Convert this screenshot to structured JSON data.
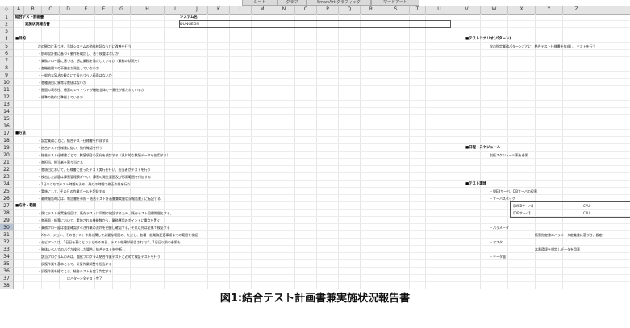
{
  "ribbon_tabs": [
    "シート",
    "グラフ",
    "SmartArt グラフィック",
    "ワードアート"
  ],
  "corner_symbol": "◇",
  "columns": [
    "A",
    "B",
    "C",
    "D",
    "E",
    "F",
    "G",
    "H",
    "I",
    "J",
    "K",
    "L",
    "M",
    "N",
    "O",
    "P",
    "Q",
    "R",
    "S",
    "T",
    "U",
    "V",
    "W",
    "X",
    "Y",
    "Z"
  ],
  "rows": [
    "1",
    "2",
    "3",
    "4",
    "5",
    "6",
    "7",
    "8",
    "9",
    "10",
    "11",
    "12",
    "13",
    "14",
    "15",
    "16",
    "17",
    "18",
    "19",
    "20",
    "21",
    "22",
    "23",
    "24",
    "25",
    "26",
    "27",
    "28",
    "29",
    "30",
    "31",
    "32",
    "33",
    "34",
    "35",
    "36",
    "37",
    "38"
  ],
  "selected_row": "30",
  "header": {
    "title": "結合テスト計画書",
    "subtitle": "実施状況報告書",
    "system_label": "システム名",
    "system_value": "DUNGEON"
  },
  "sections": {
    "purpose": "■目的",
    "method": "■方法",
    "policy": "■方針・範囲",
    "scenario": "■テストシナリオ(パターン)",
    "schedule": "■日程・スケジュール",
    "environment": "■テスト環境"
  },
  "purpose_lines": [
    "次の観点に基づき、当該システムの動作検証ならびに改善を行う",
    "・償却設計書に基づく動作を検討し、合う検査はないか",
    "・業務フロー図に基づき、想定業務を満たしているか（業務の状況を）",
    "・各機能間での不整合が発生していないか",
    "・一般的なSLAの観点にて扱いづらい画面はないか",
    "・各種項目に異常な数値はないか",
    "・画面の表示性、帳票のレイアウトが機能全体で一貫性が保たれているか",
    "・標準の動作に準拠しているか"
  ],
  "method_lines": [
    "・設定業務ごとに、結合テスト仕様書を作成する",
    "・結合テスト仕様書に従い、動作確認を行う",
    "・結合テスト仕様書ごとで、数値項目の変化を検討する（具体的な数値データを使用する）",
    "・各担当、担当者を割り当てる",
    "・各項目において、仕様書に従ったテスト実行を行い、担当者がテストを行う",
    "・検出した課題は障害管理表ぎへい、障害の発生要因及び影響範囲を付加する",
    "・1日のうちでテスト時間を決め、残りの時間で修正作業を行う",
    "・実施にして、その日の作業ボールを記録する",
    "・最終報告時には、報告書を参照・結合テスト計画書兼実施状況報告書」に転記する"
  ],
  "policy_lines": [
    "・既にテスト未実施項目は、既存テストは同期で検証するため、既存テスト目標期間とする。",
    "・各画面・帳票において、実施される機能数から、業務運用のポイントに重点を置く",
    "・業務フロー図は重要確認すべき作業の流れを把握し確認する。それ以外は全体で検証する",
    "・Xのバージョン、その他テスト作業に関して必要な範囲の、ただし、各種一般業務変更事項までの範囲を検証",
    "・セビアンスは、1日日を基にとりまとめる毎日、テスト結果が報告されれば、1日日以前の参照も",
    "・単体レベルでのバグが検出した場合、結合テストを中断し",
    "　該当プログラムのみは、強化プログラム結合作業テストと改めて検証テストを行う",
    "・反復作業を基本として、反復作業調整を担当する",
    "・反復作業を経てとき、結合テストを完了判定する",
    "　　　　　　　　　以パターン全テスト完了"
  ],
  "right_lines": {
    "scenario_desc": "次の指定業務パターンごとに、結合テスト仕様書を作成し、テストを行う",
    "schedule_desc": "別紙スケジュール表を参照",
    "env_web": "・WEBサーバ、DBサーバの役割",
    "env_server": "・サーバスペック",
    "env_websv": "【WEBサーバ】",
    "env_dbsv": "【DBサーバ】",
    "cpu": "CPU:",
    "env_params": "・パラメータ",
    "env_params_desc": "帳票指定書のパラメータ定義書に基づき、設定",
    "env_master": "・マスタ",
    "env_master_desc": "本番環境を想定しデータを用意",
    "env_data": "・データ量"
  },
  "caption": "図1:結合テスト計画書兼実施状況報告書"
}
